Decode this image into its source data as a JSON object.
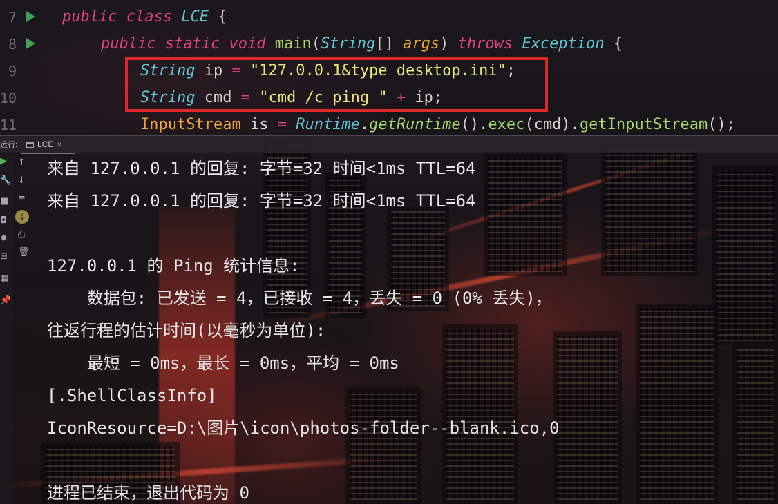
{
  "editor": {
    "lines": [
      {
        "num": "7"
      },
      {
        "num": "8"
      },
      {
        "num": "9"
      },
      {
        "num": "10"
      },
      {
        "num": "11"
      }
    ],
    "tokens": {
      "l7_kw1": "public",
      "l7_kw2": "class",
      "l7_name": "LCE",
      "l7_brace": "{",
      "l8_kw1": "public",
      "l8_kw2": "static",
      "l8_kw3": "void",
      "l8_fn": "main",
      "l8_p1": "(",
      "l8_type": "String",
      "l8_arr": "[]",
      "l8_arg": "args",
      "l8_p2": ")",
      "l8_throws": "throws",
      "l8_exc": "Exception",
      "l8_brace": "{",
      "l9_type": "String",
      "l9_var": "ip",
      "l9_eq": "=",
      "l9_str": "\"127.0.0.1&type desktop.ini\"",
      "l9_semi": ";",
      "l10_type": "String",
      "l10_var": "cmd",
      "l10_eq": "=",
      "l10_str": "\"cmd /c ping \"",
      "l10_plus": "+",
      "l10_ip": "ip",
      "l10_semi": ";",
      "l11_type": "InputStream",
      "l11_var": "is",
      "l11_eq": "=",
      "l11_cls": "Runtime",
      "l11_dot1": ".",
      "l11_fn1": "getRuntime",
      "l11_p1": "().",
      "l11_fn2": "exec",
      "l11_p2": "(cmd).",
      "l11_fn3": "getInputStream",
      "l11_p3": "();"
    }
  },
  "run_panel": {
    "label": "运行:",
    "tab_label": "LCE",
    "tab_close": "×"
  },
  "console": {
    "lines": [
      "来自 127.0.0.1 的回复: 字节=32 时间<1ms TTL=64",
      "来自 127.0.0.1 的回复: 字节=32 时间<1ms TTL=64",
      "",
      "127.0.0.1 的 Ping 统计信息:",
      "    数据包: 已发送 = 4，已接收 = 4，丢失 = 0 (0% 丢失)，",
      "往返行程的估计时间(以毫秒为单位):",
      "    最短 = 0ms，最长 = 0ms，平均 = 0ms",
      "[.ShellClassInfo]",
      "IconResource=D:\\图片\\icon\\photos-folder--blank.ico,0",
      "",
      "进程已结束，退出代码为 0"
    ]
  },
  "colors": {
    "keyword": "#e0457a",
    "type": "#5fc6d6",
    "function": "#a6d86a",
    "variable": "#f0a53a",
    "string": "#ece37a",
    "highlight_box": "#e0282a",
    "run_arrow": "#3fa15a"
  },
  "icons": {
    "gutter": [
      "run-arrow-icon",
      "fold-icon"
    ],
    "toolstrip": [
      "rerun-icon",
      "wrench-icon",
      "stop-icon",
      "camera-icon",
      "debug-icon",
      "layout-icon",
      "pin-icon",
      "up-arrow-icon",
      "down-arrow-icon",
      "soft-wrap-icon",
      "scroll-end-icon",
      "print-icon",
      "trash-icon"
    ]
  }
}
